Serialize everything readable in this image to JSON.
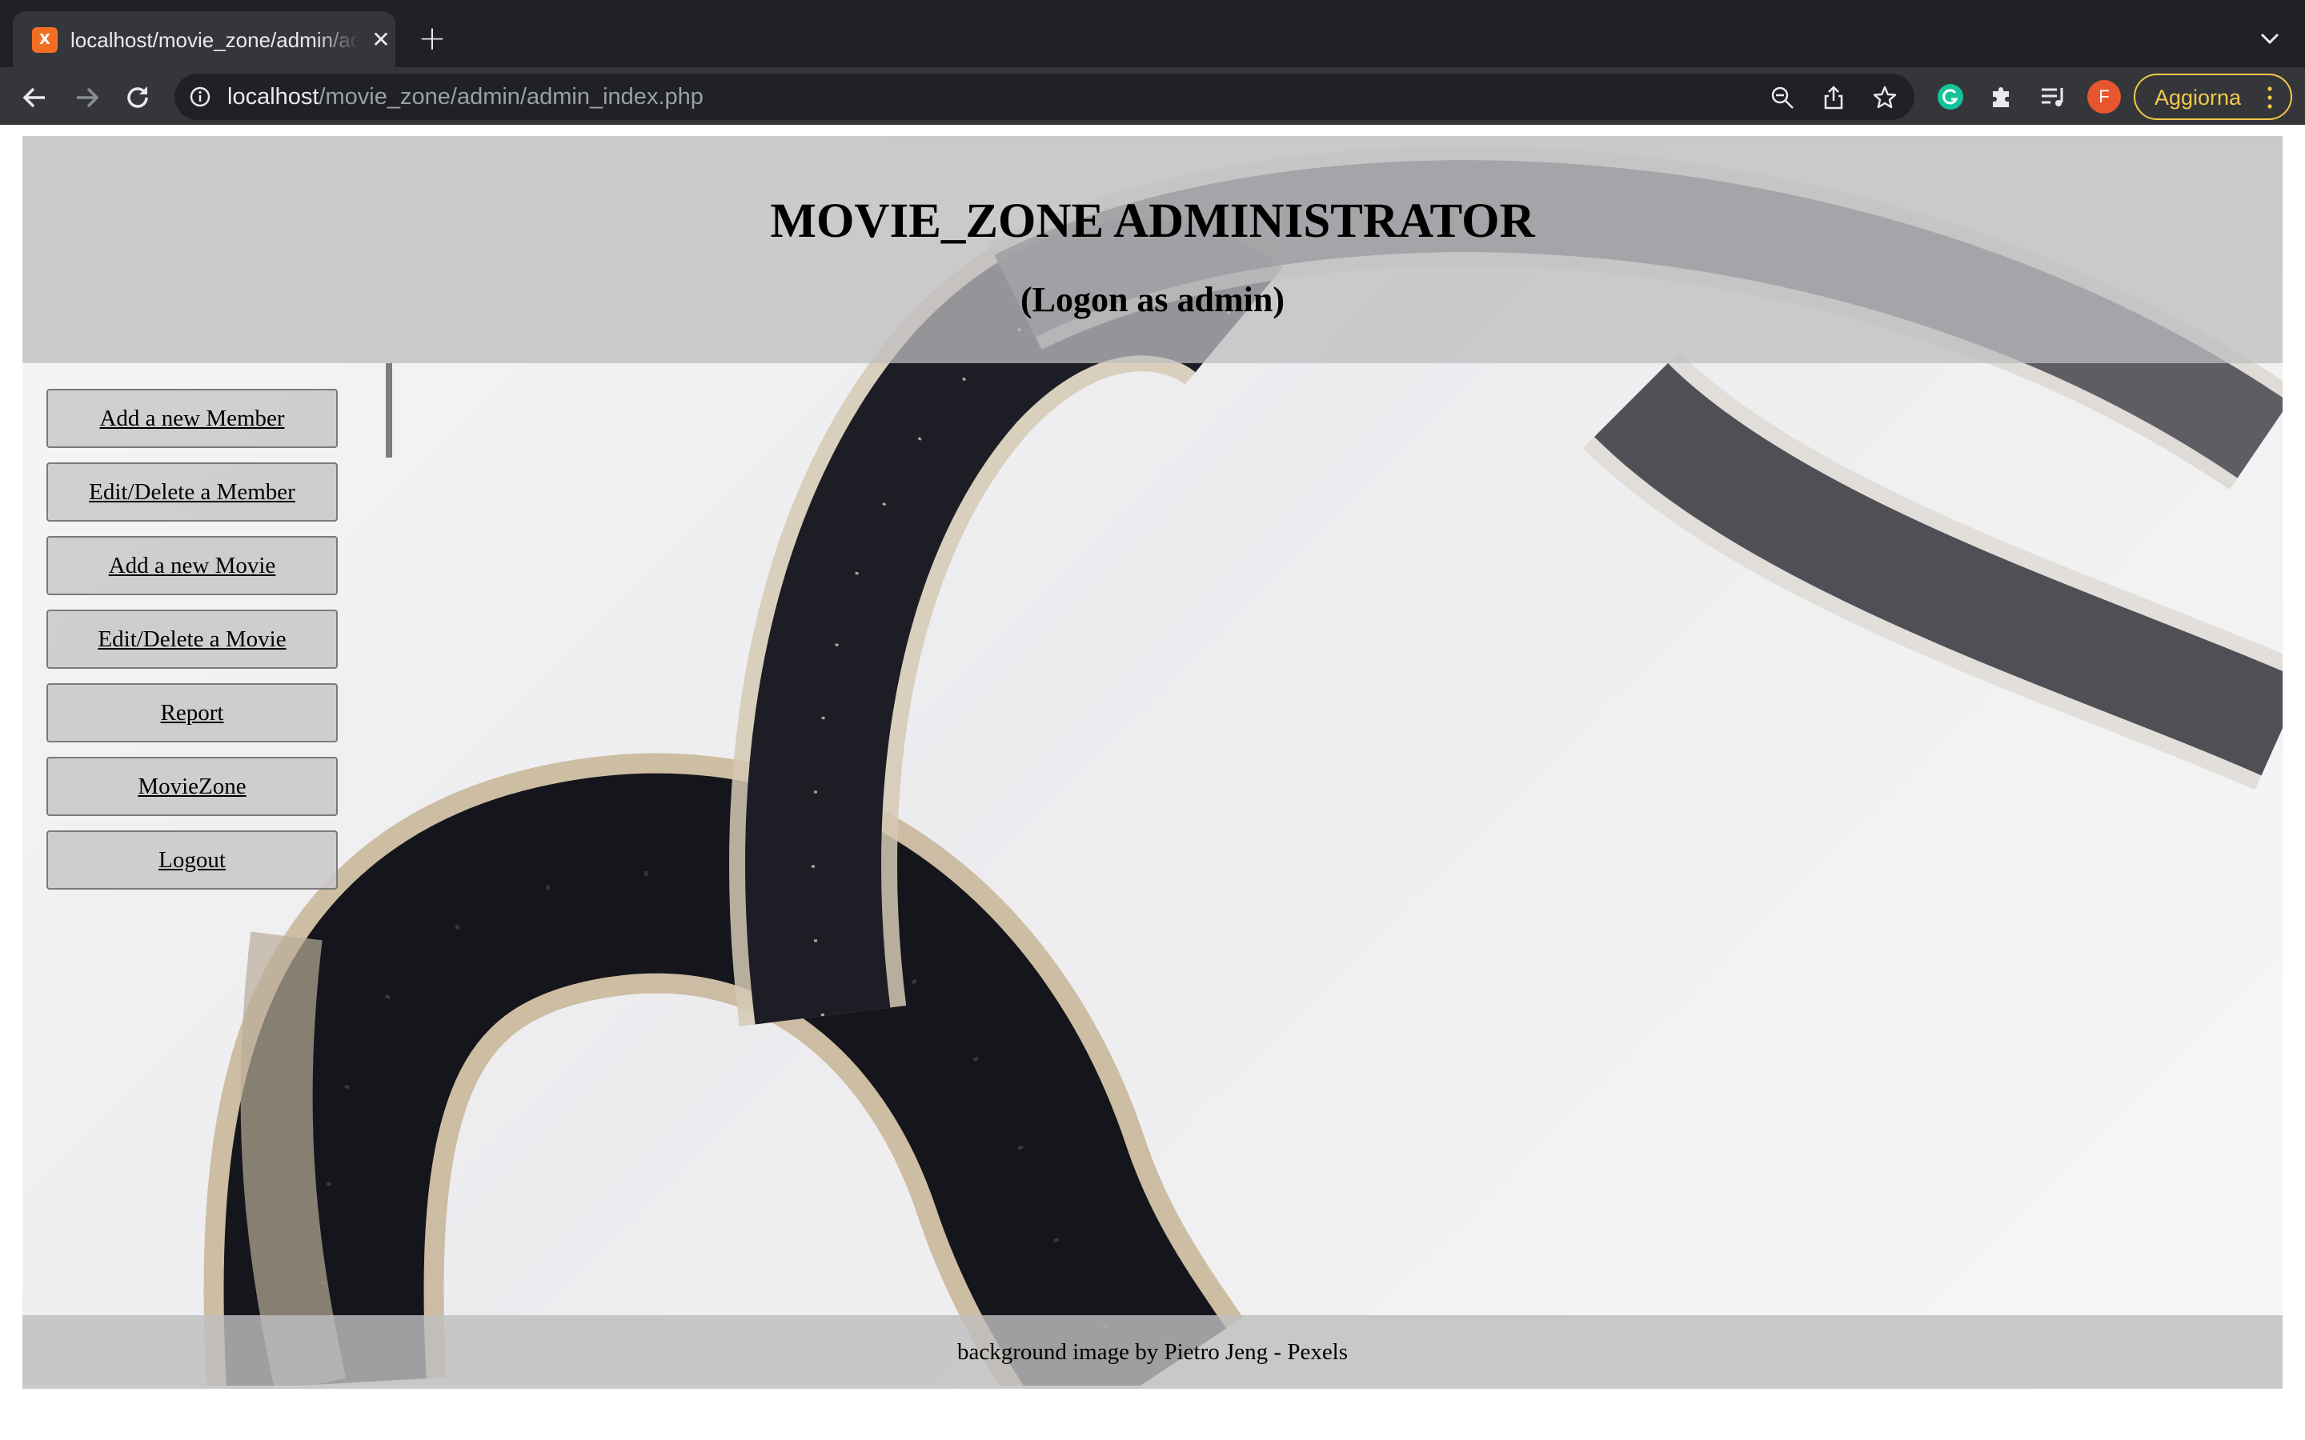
{
  "browser": {
    "tab_title": "localhost/movie_zone/admin/admin_index.php",
    "favicon_letter": "X",
    "url_host": "localhost",
    "url_path": "/movie_zone/admin/admin_index.php",
    "profile_initial": "F",
    "update_label": "Aggiorna",
    "accent_update": "#f2c94c",
    "profile_color": "#e8562f"
  },
  "header": {
    "title": "MOVIE_ZONE ADMINISTRATOR",
    "subtitle": "(Logon as admin)"
  },
  "menu": {
    "items": [
      {
        "label": "Add a new Member"
      },
      {
        "label": "Edit/Delete a Member"
      },
      {
        "label": "Add a new Movie"
      },
      {
        "label": "Edit/Delete a Movie"
      },
      {
        "label": "Report"
      },
      {
        "label": "MovieZone"
      },
      {
        "label": "Logout"
      }
    ]
  },
  "footer": {
    "credit": "background image by Pietro Jeng - Pexels"
  }
}
